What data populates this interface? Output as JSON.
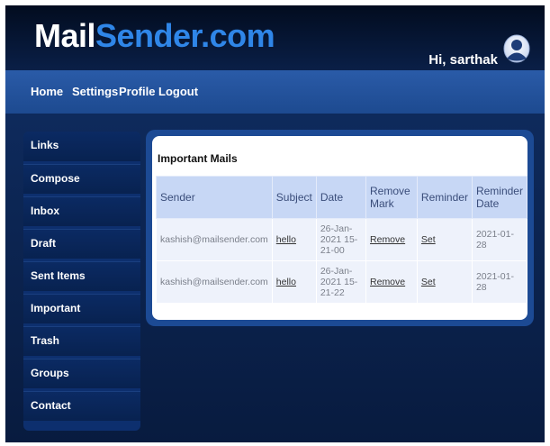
{
  "brand": {
    "part1": "Mail",
    "part2": "Sender.com"
  },
  "greeting": "Hi, sarthak",
  "nav": {
    "items": [
      "Home",
      "Settings",
      "Profile",
      "Logout"
    ]
  },
  "sidebar": {
    "items": [
      "Links",
      "Compose",
      "Inbox",
      "Draft",
      "Sent Items",
      "Important",
      "Trash",
      "Groups",
      "Contact"
    ]
  },
  "panel": {
    "title": "Important Mails",
    "columns": [
      "Sender",
      "Subject",
      "Date",
      "Remove Mark",
      "Reminder",
      "Reminder Date"
    ],
    "rows": [
      {
        "sender": "kashish@mailsender.com",
        "subject": "hello",
        "date": "26-Jan-2021 15-21-00",
        "remove": "Remove",
        "reminder": "Set",
        "reminder_date": "2021-01-28"
      },
      {
        "sender": "kashish@mailsender.com",
        "subject": "hello",
        "date": "26-Jan-2021 15-21-22",
        "remove": "Remove",
        "reminder": "Set",
        "reminder_date": "2021-01-28"
      }
    ]
  },
  "colors": {
    "brand_white": "#ffffff",
    "brand_blue": "#2f86e8",
    "nav_bg": "#2a5ba8",
    "page_bg": "#0a1f47"
  }
}
